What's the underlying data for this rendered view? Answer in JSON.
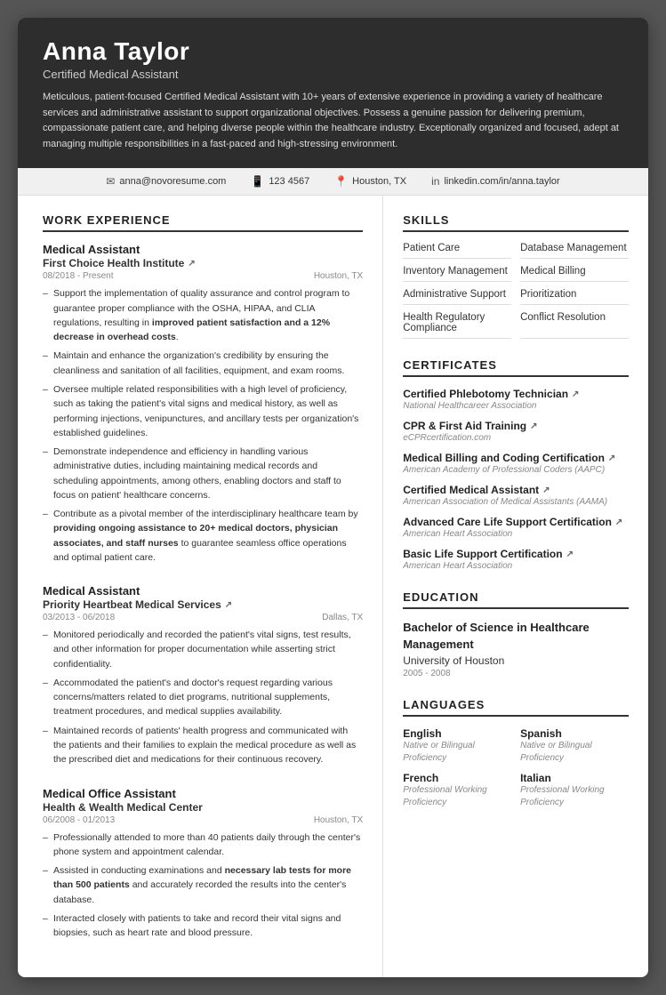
{
  "header": {
    "name": "Anna Taylor",
    "title": "Certified Medical Assistant",
    "summary": "Meticulous, patient-focused Certified Medical Assistant with 10+ years of extensive experience in providing a variety of healthcare services and administrative assistant to support organizational objectives. Possess a genuine passion for delivering premium, compassionate patient care, and helping diverse people within the healthcare industry. Exceptionally organized and focused, adept at managing multiple responsibilities in a fast-paced and high-stressing environment."
  },
  "contact": {
    "email": "anna@novoresume.com",
    "phone": "123 4567",
    "location": "Houston, TX",
    "linkedin": "linkedin.com/in/anna.taylor"
  },
  "work_experience": {
    "section_title": "WORK EXPERIENCE",
    "jobs": [
      {
        "title": "Medical Assistant",
        "company": "First Choice Health Institute",
        "dates": "08/2018 - Present",
        "location": "Houston, TX",
        "bullets": [
          "Support the implementation of quality assurance and control program to guarantee proper compliance with the OSHA, HIPAA, and CLIA regulations, resulting in improved patient satisfaction and a 12% decrease in overhead costs.",
          "Maintain and enhance the organization's credibility by ensuring the cleanliness and sanitation of all facilities, equipment, and exam rooms.",
          "Oversee multiple related responsibilities with a high level of proficiency, such as taking the patient's vital signs and medical history, as well as performing injections, venipunctures, and ancillary tests per organization's established guidelines.",
          "Demonstrate independence and efficiency in handling various administrative duties, including maintaining medical records and scheduling appointments, among others, enabling doctors and staff to focus on patient' healthcare concerns.",
          "Contribute as a pivotal member of the interdisciplinary healthcare team by providing ongoing assistance to 20+ medical doctors, physician associates, and staff nurses to guarantee seamless office operations and optimal patient care."
        ]
      },
      {
        "title": "Medical Assistant",
        "company": "Priority Heartbeat Medical Services",
        "dates": "03/2013 - 06/2018",
        "location": "Dallas, TX",
        "bullets": [
          "Monitored periodically and recorded the patient's vital signs, test results, and other information for proper documentation while asserting strict confidentiality.",
          "Accommodated the patient's and doctor's request regarding various concerns/matters related to diet programs, nutritional supplements, treatment procedures, and medical supplies availability.",
          "Maintained records of patients' health progress and communicated with the patients and their families to explain the medical procedure as well as the prescribed diet and medications for their continuous recovery."
        ]
      },
      {
        "title": "Medical Office Assistant",
        "company": "Health & Wealth Medical Center",
        "dates": "06/2008 - 01/2013",
        "location": "Houston, TX",
        "bullets": [
          "Professionally attended to more than 40 patients daily through the center's phone system and appointment calendar.",
          "Assisted in conducting examinations and necessary lab tests for more than 500 patients and accurately recorded the results into the center's database.",
          "Interacted closely with patients to take and record their vital signs and biopsies, such as heart rate and blood pressure."
        ]
      }
    ]
  },
  "skills": {
    "section_title": "SKILLS",
    "items": [
      {
        "name": "Patient Care",
        "col": 1
      },
      {
        "name": "Database Management",
        "col": 2
      },
      {
        "name": "Inventory Management",
        "col": 1
      },
      {
        "name": "Medical Billing",
        "col": 2
      },
      {
        "name": "Administrative Support",
        "col": 1
      },
      {
        "name": "Prioritization",
        "col": 2
      },
      {
        "name": "Health Regulatory Compliance",
        "col": 1
      },
      {
        "name": "Conflict Resolution",
        "col": 2
      }
    ]
  },
  "certificates": {
    "section_title": "CERTIFICATES",
    "items": [
      {
        "name": "Certified Phlebotomy Technician",
        "org": "National Healthcareer Association"
      },
      {
        "name": "CPR & First Aid Training",
        "org": "eCPRcertification.com"
      },
      {
        "name": "Medical Billing and Coding Certification",
        "org": "American Academy of Professional Coders (AAPC)"
      },
      {
        "name": "Certified Medical Assistant",
        "org": "American Association of Medical Assistants (AAMA)"
      },
      {
        "name": "Advanced Care Life Support Certification",
        "org": "American Heart Association"
      },
      {
        "name": "Basic Life Support Certification",
        "org": "American Heart Association"
      }
    ]
  },
  "education": {
    "section_title": "EDUCATION",
    "degree": "Bachelor of Science in Healthcare Management",
    "school": "University of Houston",
    "years": "2005 - 2008"
  },
  "languages": {
    "section_title": "LANGUAGES",
    "items": [
      {
        "name": "English",
        "level": "Native or Bilingual Proficiency"
      },
      {
        "name": "Spanish",
        "level": "Native or Bilingual Proficiency"
      },
      {
        "name": "French",
        "level": "Professional Working Proficiency"
      },
      {
        "name": "Italian",
        "level": "Professional Working Proficiency"
      }
    ]
  }
}
